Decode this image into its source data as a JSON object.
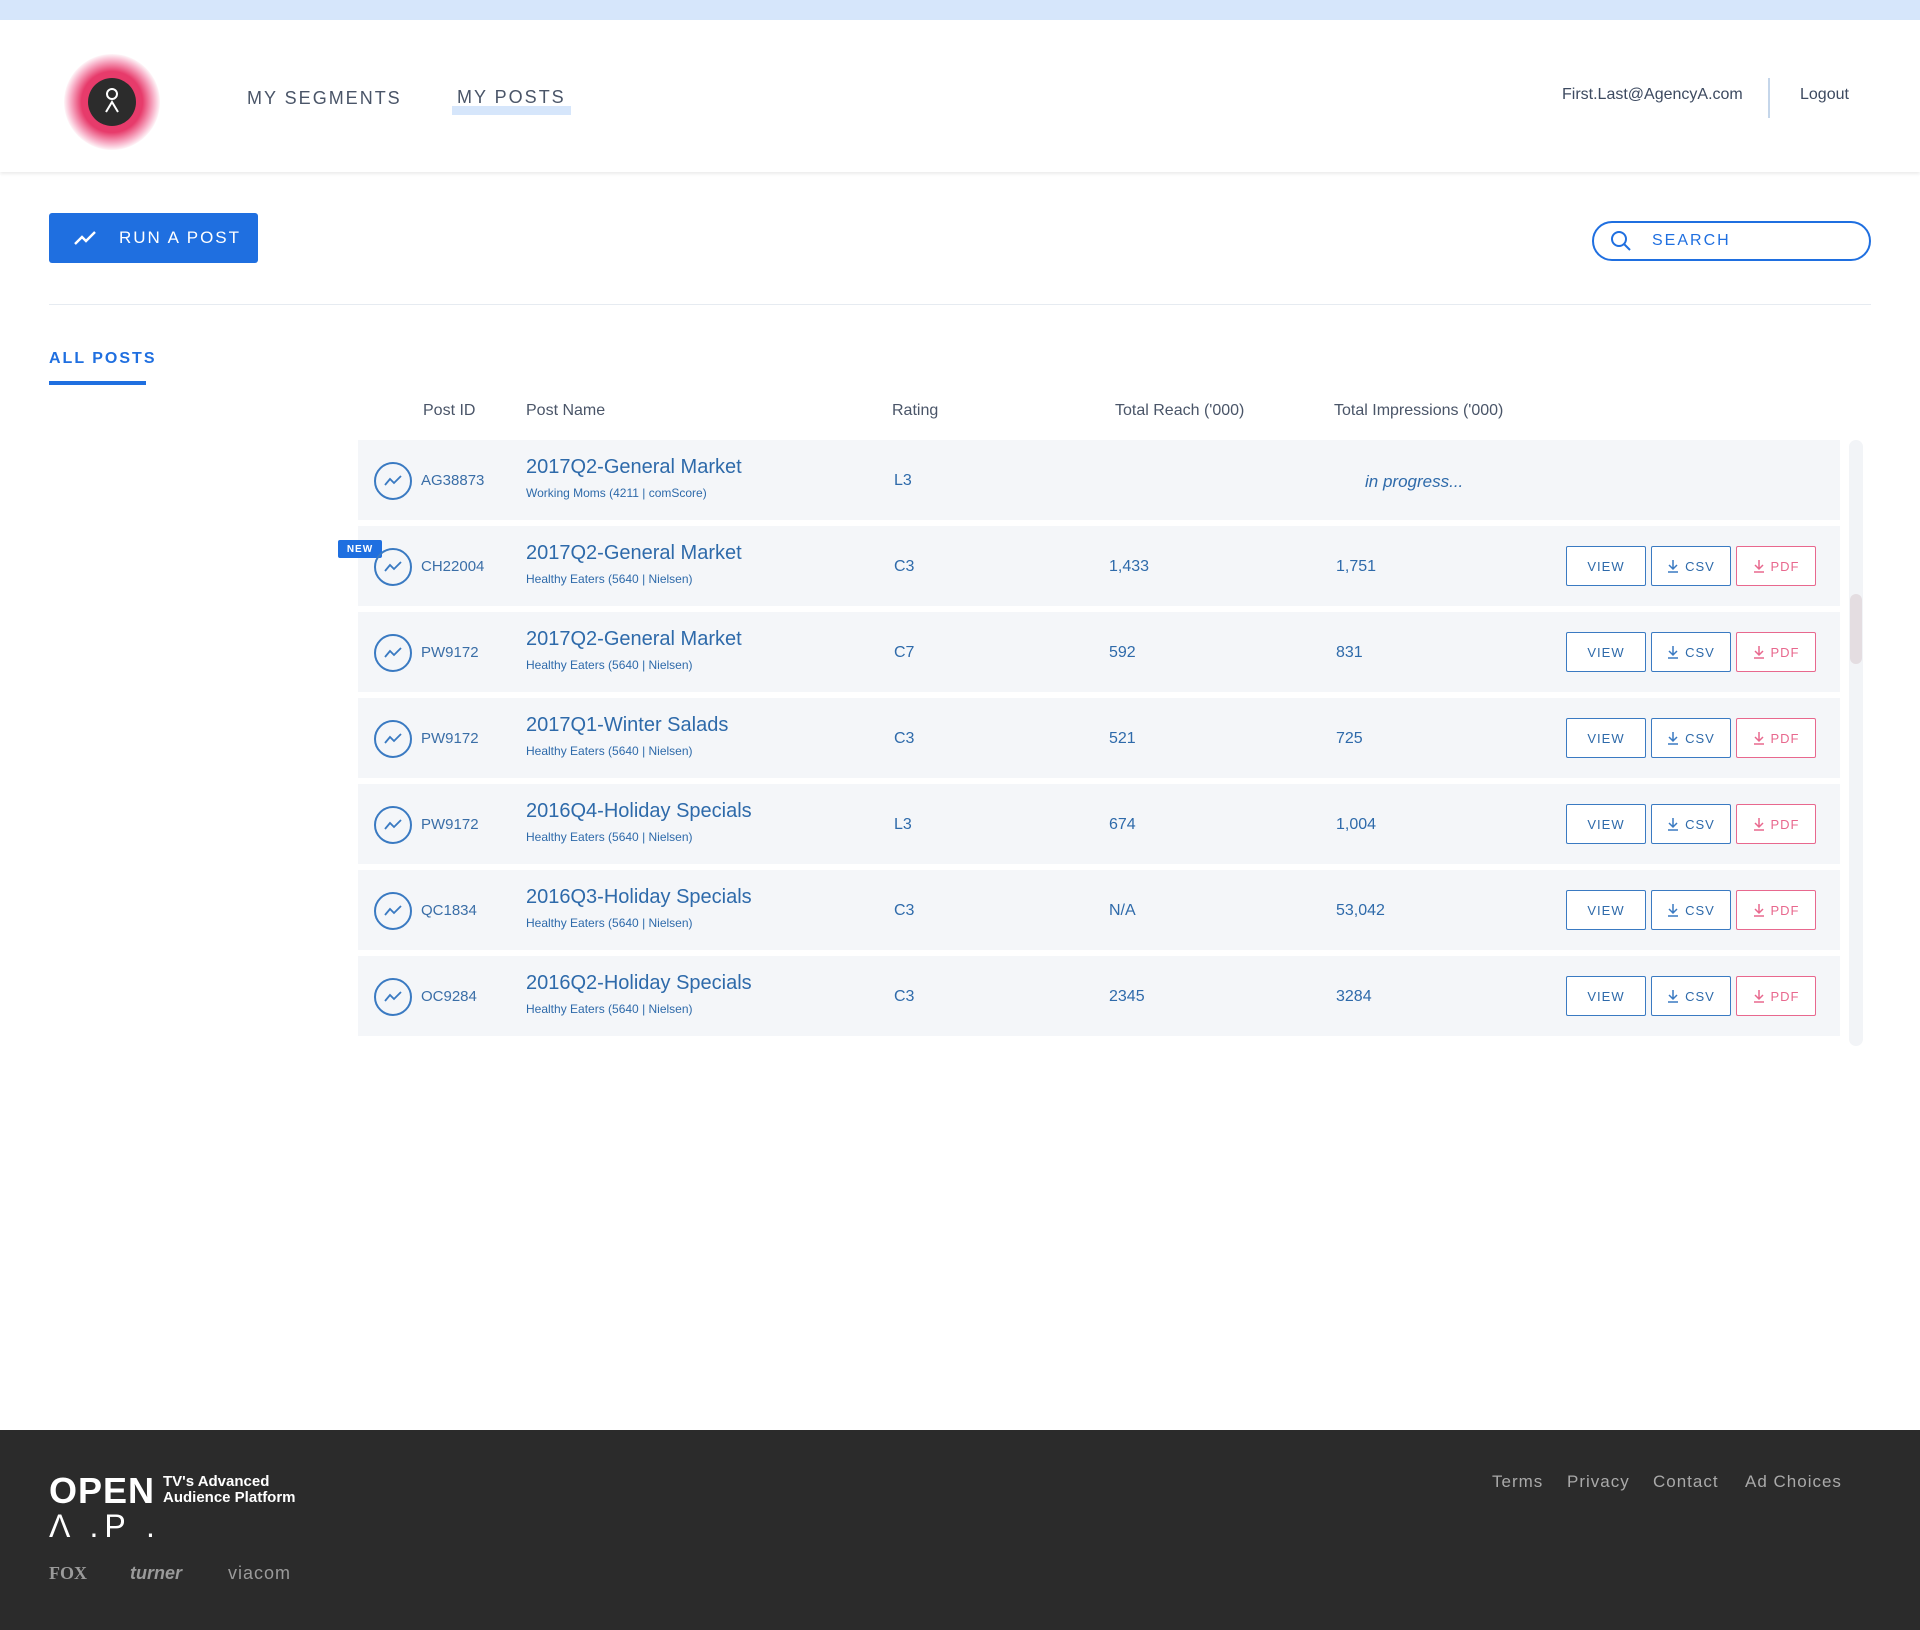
{
  "header": {
    "nav": [
      {
        "label": "MY SEGMENTS"
      },
      {
        "label": "MY POSTS"
      }
    ],
    "user_email": "First.Last@AgencyA.com",
    "logout_label": "Logout"
  },
  "toolbar": {
    "run_label": "RUN A POST",
    "search_placeholder": "SEARCH"
  },
  "tab_label": "ALL POSTS",
  "columns": {
    "post_id": "Post ID",
    "post_name": "Post Name",
    "rating": "Rating",
    "reach": "Total Reach ('000)",
    "impressions": "Total Impressions ('000)"
  },
  "actions": {
    "view": "VIEW",
    "csv": "CSV",
    "pdf": "PDF"
  },
  "new_badge": "NEW",
  "posts": [
    {
      "id": "AG38873",
      "name": "2017Q2-General Market",
      "sub": "Working Moms (4211 | comScore)",
      "rating": "L3",
      "reach": "",
      "impressions": "",
      "status": "in progress..."
    },
    {
      "id": "CH22004",
      "name": "2017Q2-General Market",
      "sub": "Healthy Eaters (5640 | Nielsen)",
      "rating": "C3",
      "reach": "1,433",
      "impressions": "1,751",
      "is_new": true
    },
    {
      "id": "PW9172",
      "name": "2017Q2-General Market",
      "sub": "Healthy Eaters (5640 | Nielsen)",
      "rating": "C7",
      "reach": "592",
      "impressions": "831"
    },
    {
      "id": "PW9172",
      "name": "2017Q1-Winter Salads",
      "sub": "Healthy Eaters (5640 | Nielsen)",
      "rating": "C3",
      "reach": "521",
      "impressions": "725"
    },
    {
      "id": "PW9172",
      "name": "2016Q4-Holiday Specials",
      "sub": "Healthy Eaters (5640 | Nielsen)",
      "rating": "L3",
      "reach": "674",
      "impressions": "1,004"
    },
    {
      "id": "QC1834",
      "name": "2016Q3-Holiday Specials",
      "sub": "Healthy Eaters (5640 | Nielsen)",
      "rating": "C3",
      "reach": "N/A",
      "impressions": "53,042"
    },
    {
      "id": "OC9284",
      "name": "2016Q2-Holiday Specials",
      "sub": "Healthy Eaters (5640 | Nielsen)",
      "rating": "C3",
      "reach": "2345",
      "impressions": "3284"
    }
  ],
  "footer": {
    "wordmark_top": "OPEN",
    "wordmark_bottom": "Λ .P .",
    "tagline_1": "TV's Advanced",
    "tagline_2": "Audience Platform",
    "partners": [
      "FOX",
      "turner",
      "viacom"
    ],
    "links": [
      "Terms",
      "Privacy",
      "Contact",
      "Ad Choices"
    ]
  },
  "colors": {
    "accent": "#1f6fe0",
    "text_link": "#2e6aaa",
    "pdf": "#e8688e",
    "footer_bg": "#2b2b2b"
  }
}
